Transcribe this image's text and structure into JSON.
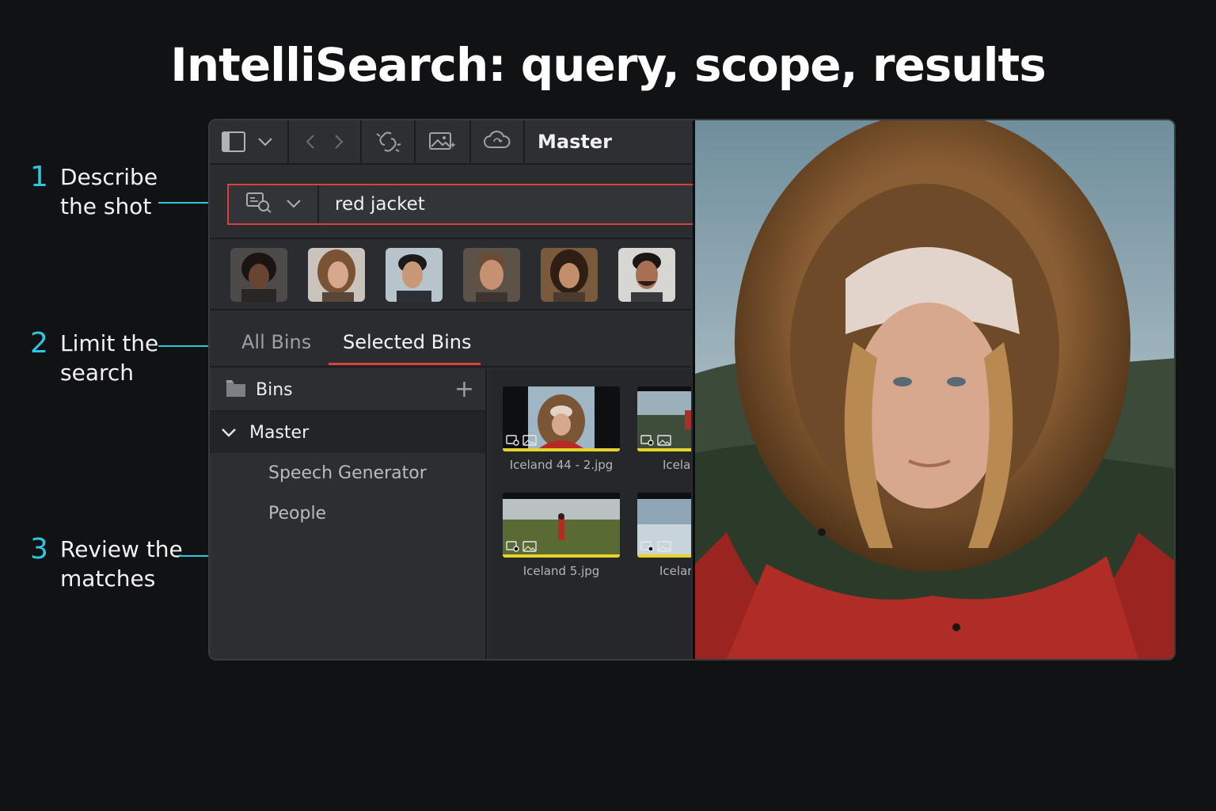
{
  "page": {
    "title": "IntelliSearch: query, scope, results"
  },
  "callouts": [
    {
      "num": "1",
      "text": "Describe\nthe shot"
    },
    {
      "num": "2",
      "text": "Limit the\nsearch"
    },
    {
      "num": "3",
      "text": "Review the\nmatches"
    }
  ],
  "toolbar": {
    "icons": [
      "panel-layout-icon",
      "chevron-down-icon",
      "back-arrow-icon",
      "forward-arrow-icon",
      "unlink-icon",
      "image-sparkle-icon",
      "cloud-sync-icon"
    ],
    "title": "Master"
  },
  "search": {
    "mode_icon": "speech-search-icon",
    "value": "red jacket",
    "accent": "#d8423e"
  },
  "faces": [
    "person-1",
    "person-2",
    "person-3",
    "person-4",
    "person-5",
    "person-6"
  ],
  "tabs": [
    {
      "label": "All Bins",
      "active": false
    },
    {
      "label": "Selected Bins",
      "active": true
    }
  ],
  "bins": {
    "header": "Bins",
    "add_icon": "+",
    "master": "Master",
    "children": [
      "Speech Generator",
      "People"
    ]
  },
  "results": [
    {
      "name": "Iceland 44 - 2.jpg"
    },
    {
      "name": "Icelar"
    },
    {
      "name": "Iceland 5.jpg"
    },
    {
      "name": "Icelar"
    }
  ],
  "colors": {
    "accent_cyan": "#2ec6e0",
    "accent_red": "#d8423e",
    "clip_bar": "#e6d42a"
  }
}
